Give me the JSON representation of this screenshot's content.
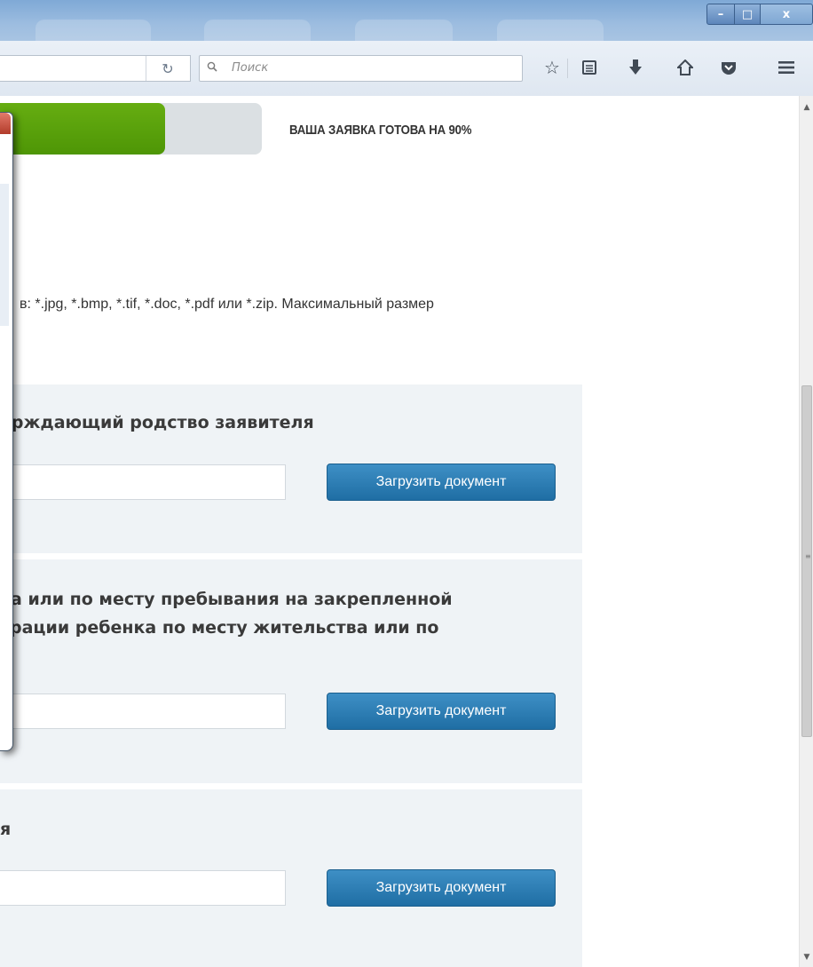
{
  "toolbar": {
    "search_placeholder": "Поиск"
  },
  "progress": {
    "label": "ВАША ЗАЯВКА ГОТОВА НА 90%",
    "fraction": 0.63
  },
  "formats_text": "в: *.jpg, *.bmp, *.tif, *.doc, *.pdf или *.zip. Максимальный размер",
  "cards": [
    {
      "title_lines": [
        "ерждающий родство заявителя"
      ],
      "button_label": "Загрузить документ"
    },
    {
      "title_lines": [
        "ва или по месту пребывания на закрепленной",
        "трации ребенка по месту жительства или по"
      ],
      "button_label": "Загрузить документ"
    },
    {
      "title_lines": [
        "я"
      ],
      "button_label": "Загрузить документ"
    }
  ]
}
